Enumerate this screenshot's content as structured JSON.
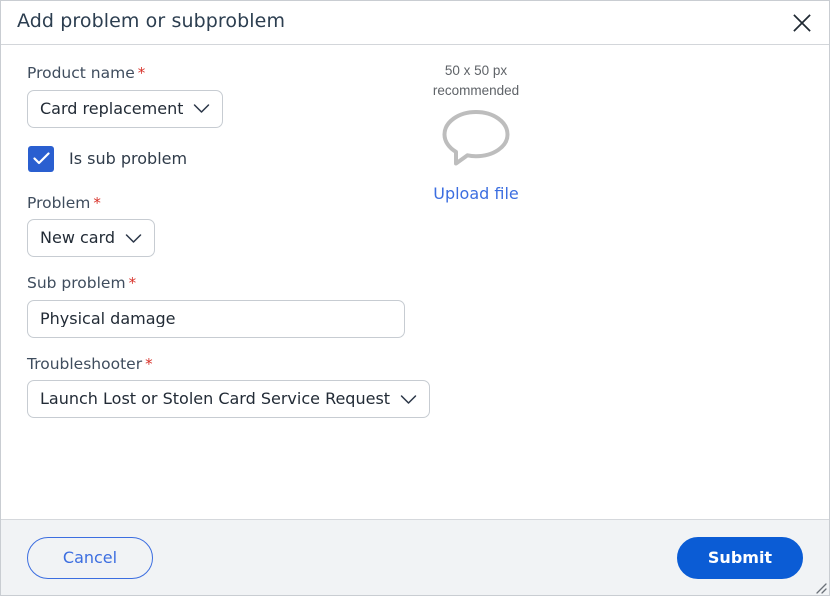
{
  "dialog": {
    "title": "Add problem or subproblem",
    "close_icon": "close-icon"
  },
  "form": {
    "product_name": {
      "label": "Product name",
      "required_marker": "*",
      "value": "Card replacement",
      "type": "select"
    },
    "is_sub_problem": {
      "label": "Is sub problem",
      "checked": true
    },
    "problem": {
      "label": "Problem",
      "required_marker": "*",
      "value": "New card",
      "type": "select"
    },
    "sub_problem": {
      "label": "Sub problem",
      "required_marker": "*",
      "value": "Physical damage",
      "placeholder": "",
      "type": "text"
    },
    "troubleshooter": {
      "label": "Troubleshooter",
      "required_marker": "*",
      "value": "Launch Lost or Stolen Card Service Request",
      "type": "select"
    }
  },
  "upload": {
    "hint_line1": "50 x 50 px",
    "hint_line2": "recommended",
    "thumb_icon": "speech-bubble-icon",
    "link_label": "Upload file"
  },
  "footer": {
    "cancel_label": "Cancel",
    "submit_label": "Submit"
  },
  "colors": {
    "accent_blue": "#0b5cd5",
    "link_blue": "#3c6ee0",
    "checkbox_blue": "#2a5fd0",
    "required_red": "#d8322a",
    "label_gray": "#3f4d5e",
    "footer_bg": "#f1f3f5",
    "border_gray": "#c7ccd2"
  }
}
